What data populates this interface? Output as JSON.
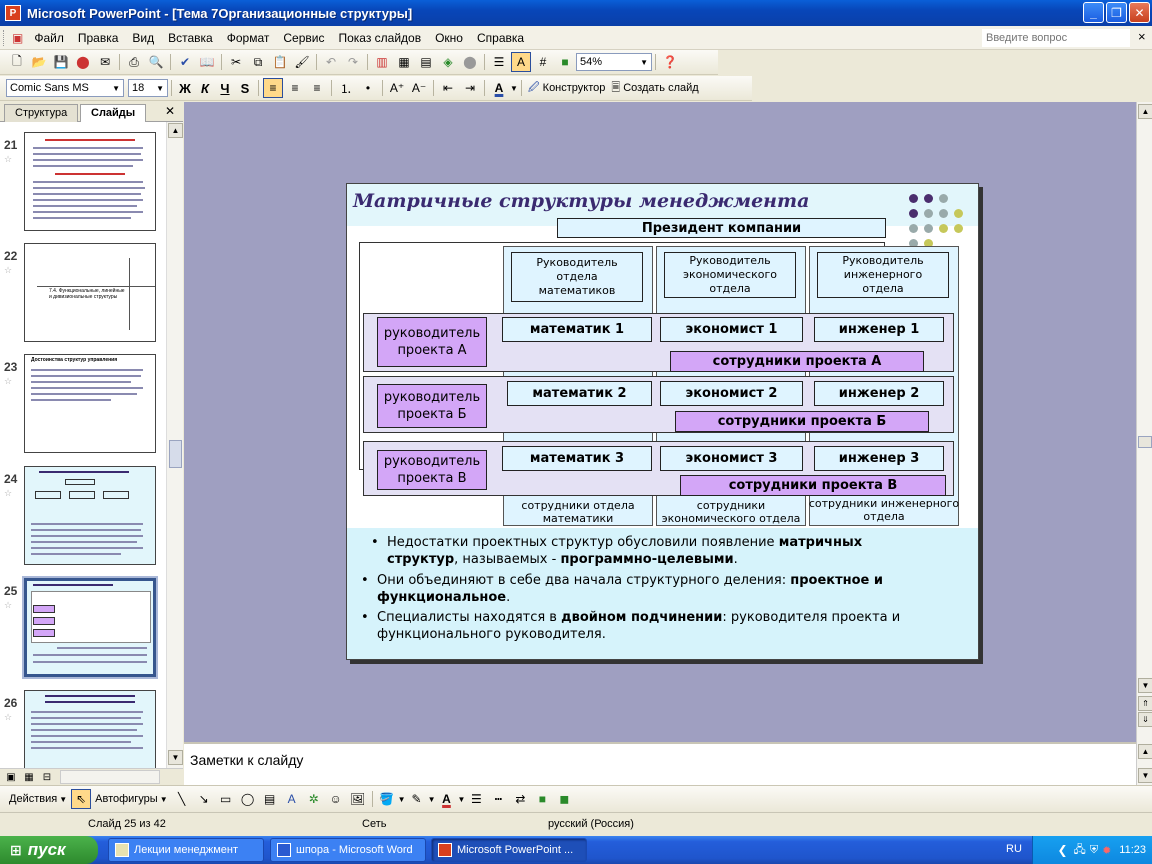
{
  "window": {
    "title": "Microsoft PowerPoint - [Тема 7Организационные структуры]",
    "controls": {
      "minimize": "_",
      "maximize": "❐",
      "close": "✕"
    }
  },
  "menu": {
    "items": [
      "Файл",
      "Правка",
      "Вид",
      "Вставка",
      "Формат",
      "Сервис",
      "Показ слайдов",
      "Окно",
      "Справка"
    ],
    "ask_placeholder": "Введите вопрос",
    "close_doc": "×"
  },
  "toolbar_standard": {
    "zoom": "54%"
  },
  "toolbar_format": {
    "font": "Comic Sans MS",
    "size": "18",
    "bold": "Ж",
    "italic": "К",
    "underline": "Ч",
    "shadow": "S",
    "designer": "Конструктор",
    "new_slide": "Создать слайд"
  },
  "panel": {
    "tabs": [
      "Структура",
      "Слайды"
    ],
    "close": "✕",
    "slides": [
      {
        "num": "21",
        "caption": ""
      },
      {
        "num": "22",
        "caption": "7.4. Функциональные, линейные и дивизиональные структуры"
      },
      {
        "num": "23",
        "caption": "Достоинства структур управления"
      },
      {
        "num": "24",
        "caption": ""
      },
      {
        "num": "25",
        "caption": ""
      },
      {
        "num": "26",
        "caption": ""
      }
    ],
    "selected": "25"
  },
  "slide": {
    "title": "Матричные структуры менеджмента",
    "president": "Президент компании",
    "dept_heads": [
      "Руководитель отдела математиков",
      "Руководитель экономического отдела",
      "Руководитель инженерного отдела"
    ],
    "projects": [
      {
        "head": "руководитель проекта А",
        "members": [
          "математик 1",
          "экономист 1",
          "инженер 1"
        ],
        "staff": "сотрудники проекта А"
      },
      {
        "head": "руководитель проекта Б",
        "members": [
          "математик 2",
          "экономист 2",
          "инженер 2"
        ],
        "staff": "сотрудники проекта Б"
      },
      {
        "head": "руководитель проекта В",
        "members": [
          "математик 3",
          "экономист 3",
          "инженер 3"
        ],
        "staff": "сотрудники проекта В"
      }
    ],
    "dept_staff": [
      "сотрудники отдела математики",
      "сотрудники экономического отдела",
      "сотрудники инженерного отдела"
    ],
    "bullets": {
      "b1_pre": "Недостатки проектных структур обусловили появление ",
      "b1_bold1": "матричных структур",
      "b1_mid": ", называемых - ",
      "b1_bold2": "программно-целевыми",
      "b1_end": ".",
      "b2_pre": "Они объединяют в себе два начала структурного деления: ",
      "b2_bold": "проектное и функциональное",
      "b2_end": ".",
      "b3_pre": "Специалисты находятся в ",
      "b3_bold": "двойном подчинении",
      "b3_end": ": руководителя проекта и функционального руководителя."
    }
  },
  "notes": {
    "text": "Заметки к слайду"
  },
  "drawbar": {
    "actions": "Действия",
    "autoshapes": "Автофигуры"
  },
  "status": {
    "slide": "Слайд 25 из 42",
    "design": "Сеть",
    "language": "русский (Россия)"
  },
  "taskbar": {
    "start": "пуск",
    "tasks": [
      "Лекции менеджмент",
      "шпора - Microsoft Word",
      "Microsoft PowerPoint ..."
    ],
    "lang": "RU",
    "clock": "11:23"
  }
}
